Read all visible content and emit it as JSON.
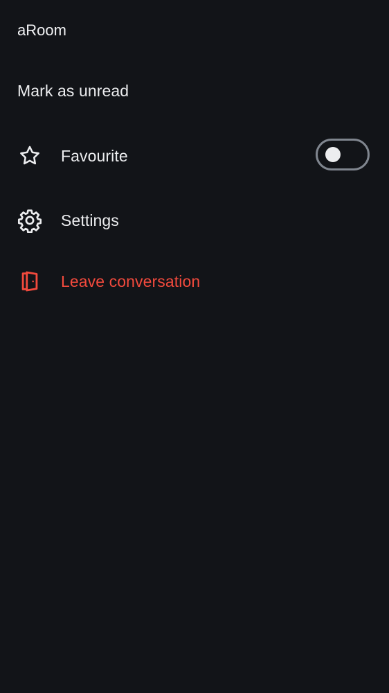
{
  "header": {
    "room_name": "aRoom"
  },
  "menu": {
    "mark_unread_label": "Mark as unread",
    "favourite": {
      "label": "Favourite",
      "icon": "star-icon",
      "toggle_on": false
    },
    "settings": {
      "label": "Settings",
      "icon": "gear-icon"
    },
    "leave": {
      "label": "Leave conversation",
      "icon": "door-exit-icon"
    }
  },
  "colors": {
    "background": "#121418",
    "text": "#ECEDEF",
    "destructive": "#F24A3D",
    "toggle_border": "#80868F"
  }
}
